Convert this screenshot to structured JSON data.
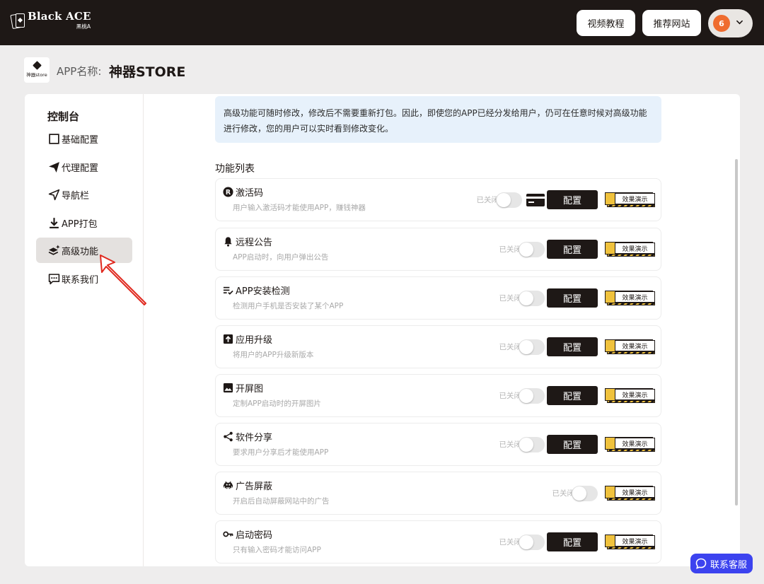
{
  "brand": {
    "title": "Black ACE",
    "subtitle": "黑桃A"
  },
  "header": {
    "video_tutorial": "视频教程",
    "recommend_site": "推荐网站",
    "user_badge": "6"
  },
  "app": {
    "icon_text": "神器store",
    "label": "APP名称:",
    "name": "神器STORE"
  },
  "sidebar": {
    "title": "控制台",
    "items": [
      {
        "label": "基础配置",
        "icon": "square-icon"
      },
      {
        "label": "代理配置",
        "icon": "paper-plane-icon"
      },
      {
        "label": "导航栏",
        "icon": "navigation-icon"
      },
      {
        "label": "APP打包",
        "icon": "download-icon"
      },
      {
        "label": "高级功能",
        "icon": "layers-sparkle-icon",
        "active": true
      },
      {
        "label": "联系我们",
        "icon": "chat-icon"
      }
    ]
  },
  "notice": "高级功能可随时修改，修改后不需要重新打包。因此，即使您的APP已经分发给用户，仍可在任意时候对高级功能进行修改，您的用户可以实时看到修改变化。",
  "feature_list_title": "功能列表",
  "labels": {
    "status_off": "已关闭",
    "config": "配置",
    "demo": "效果演示"
  },
  "features": [
    {
      "name": "激活码",
      "desc": "用户输入激活码才能使用APP，赚钱神器",
      "icon": "registered-icon",
      "has_config": true,
      "has_card": true
    },
    {
      "name": "远程公告",
      "desc": "APP启动时，向用户弹出公告",
      "icon": "bell-icon",
      "has_config": true
    },
    {
      "name": "APP安装检测",
      "desc": "检测用户手机是否安装了某个APP",
      "icon": "checklist-icon",
      "has_config": true
    },
    {
      "name": "应用升级",
      "desc": "将用户的APP升级新版本",
      "icon": "upload-box-icon",
      "has_config": true
    },
    {
      "name": "开屏图",
      "desc": "定制APP启动时的开屏图片",
      "icon": "image-icon",
      "has_config": true
    },
    {
      "name": "软件分享",
      "desc": "要求用户分享后才能使用APP",
      "icon": "share-icon",
      "has_config": true
    },
    {
      "name": "广告屏蔽",
      "desc": "开启后自动屏蔽网站中的广告",
      "icon": "space-invader-icon",
      "has_config": false
    },
    {
      "name": "启动密码",
      "desc": "只有输入密码才能访问APP",
      "icon": "key-icon",
      "has_config": true
    }
  ],
  "support": "联系客服"
}
